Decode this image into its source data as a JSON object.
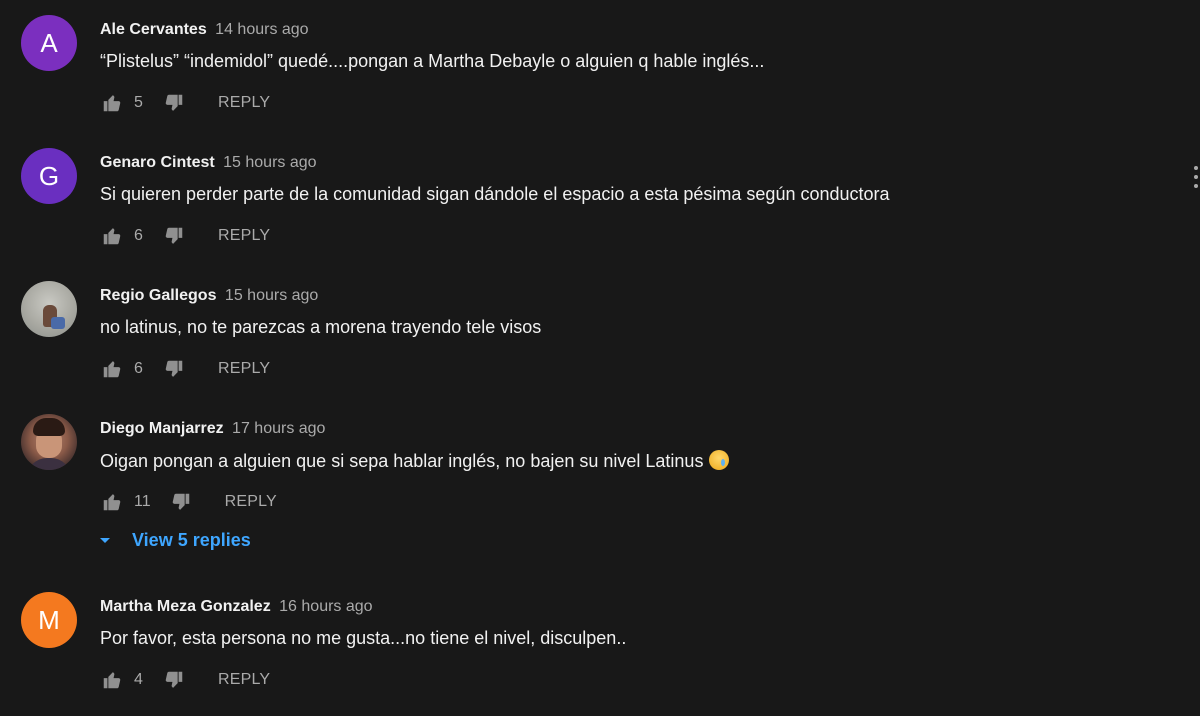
{
  "comments": [
    {
      "avatar_letter": "A",
      "avatar_color": "#7b2fbf",
      "author": "Ale Cervantes",
      "time": "14 hours ago",
      "text": "“Plistelus” “indemidol” quedé....pongan a Martha Debayle  o alguien q hable inglés...",
      "likes": "5",
      "reply_label": "REPLY"
    },
    {
      "avatar_letter": "G",
      "avatar_color": "#6a2fc0",
      "author": "Genaro Cintest",
      "time": "15 hours ago",
      "text": "Si quieren perder parte de la comunidad sigan dándole el espacio a esta pésima según conductora",
      "likes": "6",
      "reply_label": "REPLY"
    },
    {
      "avatar_letter": "",
      "author": "Regio Gallegos",
      "time": "15 hours ago",
      "text": "no latinus, no te parezcas a morena trayendo tele visos",
      "likes": "6",
      "reply_label": "REPLY"
    },
    {
      "avatar_letter": "",
      "author": "Diego Manjarrez",
      "time": "17 hours ago",
      "text": "Oigan pongan a alguien que si sepa hablar inglés, no bajen su nivel Latinus",
      "emoji": "crying-face-emoji",
      "likes": "11",
      "reply_label": "REPLY",
      "view_replies_label": "View 5 replies"
    },
    {
      "avatar_letter": "M",
      "avatar_color": "#f4791f",
      "author": "Martha Meza Gonzalez",
      "time": "16 hours ago",
      "text": "Por favor, esta persona no me gusta...no tiene el nivel, disculpen..",
      "likes": "4",
      "reply_label": "REPLY"
    }
  ],
  "icons": {
    "like": "thumb-up-icon",
    "dislike": "thumb-down-icon",
    "menu": "more-vertical-icon",
    "expand": "caret-down-icon"
  },
  "colors": {
    "background": "#181818",
    "link_blue": "#3ea6ff",
    "secondary_text": "#aaaaaa"
  }
}
